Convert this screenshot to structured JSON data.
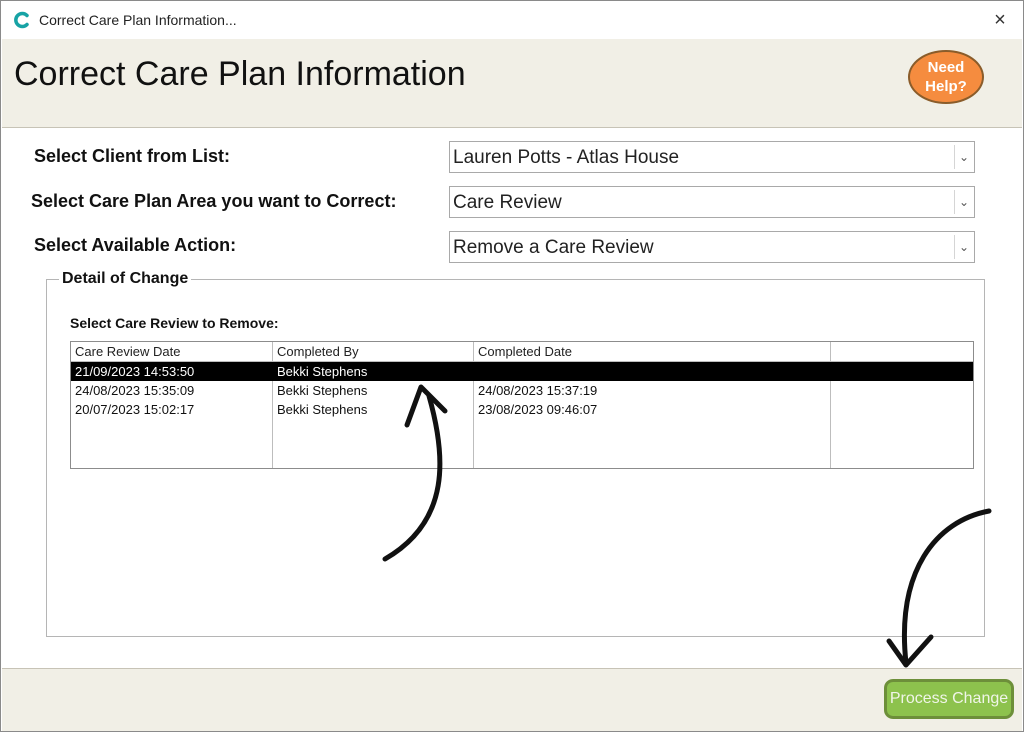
{
  "window": {
    "title": "Correct Care Plan Information...",
    "close_glyph": "×",
    "app_icon": "c-logo-icon"
  },
  "header": {
    "title": "Correct Care Plan Information",
    "help_line1": "Need",
    "help_line2": "Help?",
    "help_color": "#f58c3f"
  },
  "form": {
    "client_label": "Select Client from List:",
    "client_value": "Lauren Potts - Atlas House",
    "area_label": "Select Care Plan Area you want to Correct:",
    "area_value": "Care Review",
    "action_label": "Select Available Action:",
    "action_value": "Remove a Care Review"
  },
  "detail": {
    "legend": "Detail of Change",
    "list_label": "Select Care Review to Remove:",
    "columns": [
      "Care Review Date",
      "Completed By",
      "Completed Date",
      ""
    ],
    "rows": [
      {
        "date": "21/09/2023 14:53:50",
        "by": "Bekki Stephens",
        "completed": "",
        "selected": true
      },
      {
        "date": "24/08/2023 15:35:09",
        "by": "Bekki Stephens",
        "completed": "24/08/2023 15:37:19",
        "selected": false
      },
      {
        "date": "20/07/2023 15:02:17",
        "by": "Bekki Stephens",
        "completed": "23/08/2023 09:46:07",
        "selected": false
      }
    ]
  },
  "footer": {
    "process_label": "Process Change",
    "process_color": "#8dc24d"
  },
  "annotations": {
    "arrow_icon_1": "curved-arrow-up-icon",
    "arrow_icon_2": "curved-arrow-down-icon"
  }
}
